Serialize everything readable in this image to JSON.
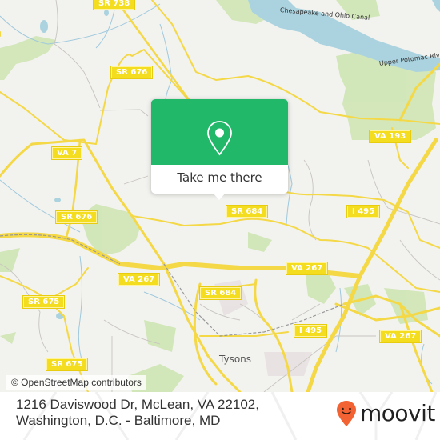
{
  "popup": {
    "cta_label": "Take me there",
    "icon": "location-pin-icon",
    "accent_color": "#21b86a"
  },
  "map": {
    "attribution": "© OpenStreetMap contributors",
    "road_shields": [
      {
        "label": "SR 738"
      },
      {
        "label": "SR 676"
      },
      {
        "label": "VA 7"
      },
      {
        "label": "SR 676"
      },
      {
        "label": "VA 193"
      },
      {
        "label": "SR 684"
      },
      {
        "label": "I 495"
      },
      {
        "label": "VA 267"
      },
      {
        "label": "VA 267"
      },
      {
        "label": "SR 675"
      },
      {
        "label": "SR 684"
      },
      {
        "label": "I 495"
      },
      {
        "label": "VA 267"
      },
      {
        "label": "SR 675"
      }
    ],
    "places": [
      {
        "label": "Tysons"
      }
    ],
    "water_labels": [
      {
        "label": "Chesapeake and Ohio Canal"
      },
      {
        "label": "Upper Potomac River"
      }
    ]
  },
  "footer": {
    "address": "1216 Daviswood Dr, McLean, VA 22102, Washington, D.C. - Baltimore, MD",
    "brand": "moovit",
    "brand_color": "#f26232"
  }
}
